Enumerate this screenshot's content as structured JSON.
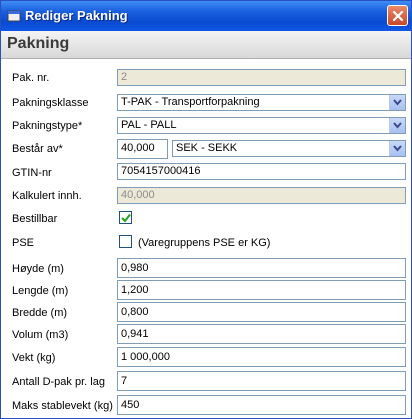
{
  "window": {
    "title": "Rediger Pakning",
    "close_icon": "close-icon"
  },
  "header": {
    "title": "Pakning"
  },
  "form": {
    "pak_nr": {
      "label": "Pak. nr.",
      "value": "2"
    },
    "pakningsklasse": {
      "label": "Pakningsklasse",
      "value": "T-PAK - Transportforpakning"
    },
    "pakningstype": {
      "label": "Pakningstype*",
      "value": "PAL - PALL"
    },
    "bestar_av": {
      "label": "Består av*",
      "quantity": "40,000",
      "unit": "SEK - SEKK"
    },
    "gtin": {
      "label": "GTIN-nr",
      "value": "7054157000416"
    },
    "kalkulert": {
      "label": "Kalkulert innh.",
      "value": "40,000"
    },
    "bestillbar": {
      "label": "Bestillbar",
      "checked": true
    },
    "pse": {
      "label": "PSE",
      "checked": false,
      "text": "(Varegruppens PSE er KG)"
    },
    "hoyde": {
      "label": "Høyde (m)",
      "value": "0,980"
    },
    "lengde": {
      "label": "Lengde (m)",
      "value": "1,200"
    },
    "bredde": {
      "label": "Bredde (m)",
      "value": "0,800"
    },
    "volum": {
      "label": "Volum (m3)",
      "value": "0,941"
    },
    "vekt": {
      "label": "Vekt (kg)",
      "value": "1 000,000"
    },
    "antall_dpak": {
      "label": "Antall D-pak pr. lag",
      "value": "7"
    },
    "maks_stablevekt": {
      "label": "Maks stablevekt (kg)",
      "value": "450"
    }
  },
  "colors": {
    "titlebar": "#0a4ad0",
    "readonly_bg": "#ece9d8",
    "input_border": "#7f9db9",
    "check_green": "#21a121"
  }
}
